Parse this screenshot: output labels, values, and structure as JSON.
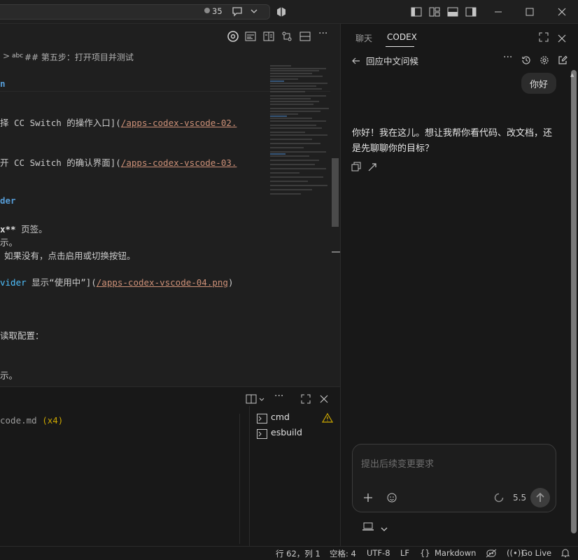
{
  "titlebar": {
    "counter": "35",
    "icons": [
      "circle-dot-icon",
      "chat-sparkle-icon",
      "chevron-down-icon",
      "copilot-icon",
      "layout-sidebar-left-icon",
      "layout-grid-icon",
      "layout-panel-icon",
      "layout-sidebar-right-icon",
      "minimize-icon",
      "maximize-icon",
      "close-icon"
    ]
  },
  "editor": {
    "breadcrumb_sep": ">",
    "breadcrumb_abc": "abc",
    "breadcrumb_text": "## 第五步：打开项目并测试",
    "lines": {
      "l1": "n",
      "l2a": "择 CC Switch 的操作入口](",
      "l2b": "/apps-codex-vscode-02.",
      "l3a": "开 CC Switch 的确认界面](",
      "l3b": "/apps-codex-vscode-03.",
      "l4": "der",
      "l5a": "x**",
      "l5b": " 页签。",
      "l6": "示。",
      "l7": "如果没有，点击启用或切换按钮。",
      "l8a": "vider",
      "l8b": " 显示“使用中”](",
      "l8c": "/apps-codex-vscode-04.png",
      "l8d": ")",
      "l9": "读取配置：",
      "l10": "示。"
    }
  },
  "panel": {
    "problem_file": "code.md",
    "problem_count": "(x4)",
    "terminals": [
      {
        "name": "cmd",
        "warning": true
      },
      {
        "name": "esbuild",
        "warning": false
      }
    ]
  },
  "side": {
    "tabs": [
      "聊天",
      "CODEX"
    ],
    "active_tab": "CODEX",
    "thread_title": "回应中文问候",
    "user_message": "你好",
    "assistant_message": "你好！我在这儿。想让我帮你看代码、改文档，还是先聊聊你的目标？",
    "composer_placeholder": "提出后续变更要求",
    "model_version": "5.5"
  },
  "statusbar": {
    "position": "行 62，列 1",
    "spaces": "空格: 4",
    "encoding": "UTF-8",
    "eol": "LF",
    "language": "Markdown",
    "golive": "Go Live"
  }
}
